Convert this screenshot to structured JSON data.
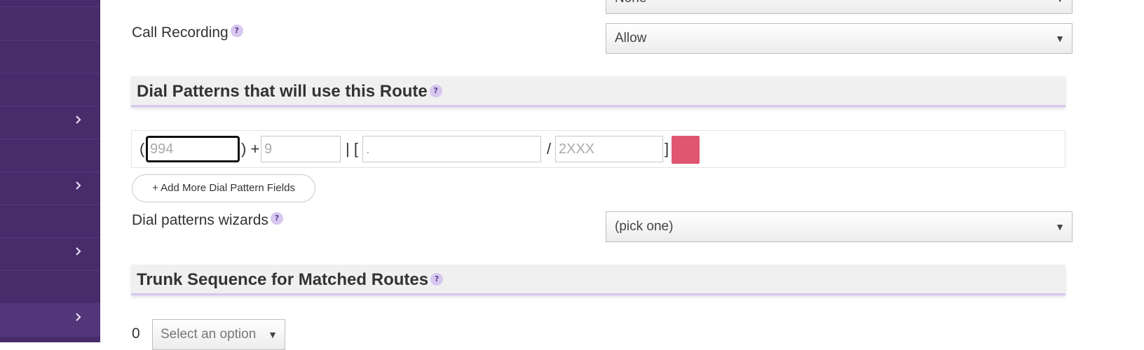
{
  "form": {
    "top_select_value": "None",
    "call_recording": {
      "label": "Call Recording",
      "help": "?",
      "value": "Allow"
    },
    "dial_patterns_section": {
      "title": "Dial Patterns that will use this Route",
      "help": "?"
    },
    "dial_pattern_row": {
      "open_paren": "(",
      "prepend": "994",
      "close_plus": ") +",
      "prefix": "9",
      "pipe_bracket": "| [",
      "callerid": ".",
      "slash": "/",
      "match_pattern": "2XXX",
      "close_bracket": "]"
    },
    "add_more_label": "+ Add More Dial Pattern Fields",
    "dial_wizards": {
      "label": "Dial patterns wizards",
      "help": "?",
      "value": "(pick one)"
    },
    "trunk_section": {
      "title": "Trunk Sequence for Matched Routes",
      "help": "?"
    },
    "trunk_sequence": {
      "index": "0",
      "placeholder": "Select an option"
    },
    "dropdown_arrow": "▼"
  },
  "colors": {
    "sidebar": "#472b6b",
    "accent": "#d6c6ee",
    "delete": "#e05570"
  }
}
